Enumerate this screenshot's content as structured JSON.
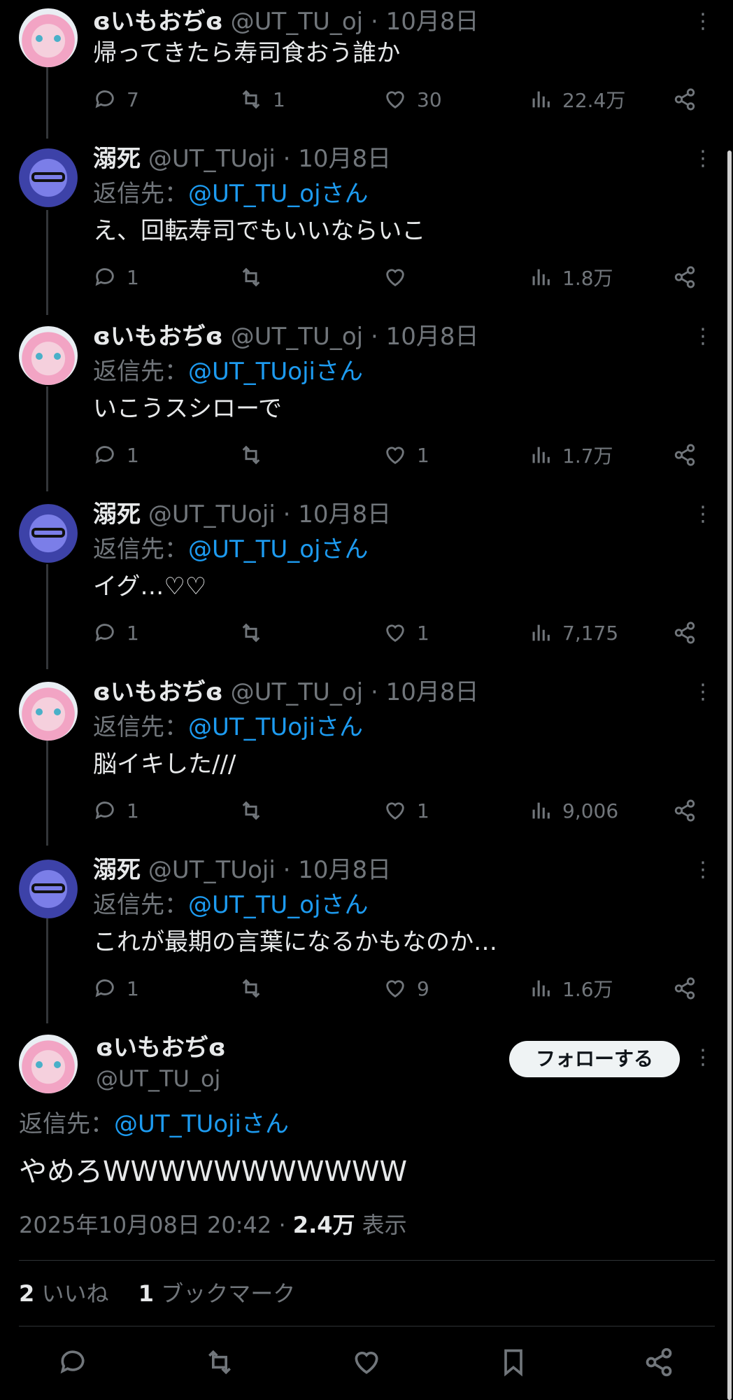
{
  "tweets": [
    {
      "name": "ɞいもおぢɞ",
      "handle": "@UT_TU_oj",
      "sep": "·",
      "date": "10月8日",
      "reply_prefix": "",
      "reply_mention": "",
      "text": "帰ってきたら寿司食おう誰か",
      "replies": "7",
      "retweets": "1",
      "likes": "30",
      "views": "22.4万"
    },
    {
      "name": "溺死",
      "handle": "@UT_TUoji",
      "sep": "·",
      "date": "10月8日",
      "reply_prefix": "返信先：",
      "reply_mention": "@UT_TU_ojさん",
      "text": "え、回転寿司でもいいならいこ",
      "replies": "1",
      "retweets": "",
      "likes": "",
      "views": "1.8万"
    },
    {
      "name": "ɞいもおぢɞ",
      "handle": "@UT_TU_oj",
      "sep": "·",
      "date": "10月8日",
      "reply_prefix": "返信先：",
      "reply_mention": "@UT_TUojiさん",
      "text": "いこうスシローで",
      "replies": "1",
      "retweets": "",
      "likes": "1",
      "views": "1.7万"
    },
    {
      "name": "溺死",
      "handle": "@UT_TUoji",
      "sep": "·",
      "date": "10月8日",
      "reply_prefix": "返信先：",
      "reply_mention": "@UT_TU_ojさん",
      "text": "イグ…♡♡",
      "replies": "1",
      "retweets": "",
      "likes": "1",
      "views": "7,175"
    },
    {
      "name": "ɞいもおぢɞ",
      "handle": "@UT_TU_oj",
      "sep": "·",
      "date": "10月8日",
      "reply_prefix": "返信先：",
      "reply_mention": "@UT_TUojiさん",
      "text": "脳イキした///",
      "replies": "1",
      "retweets": "",
      "likes": "1",
      "views": "9,006"
    },
    {
      "name": "溺死",
      "handle": "@UT_TUoji",
      "sep": "·",
      "date": "10月8日",
      "reply_prefix": "返信先：",
      "reply_mention": "@UT_TU_ojさん",
      "text": "これが最期の言葉になるかもなのか…",
      "replies": "1",
      "retweets": "",
      "likes": "9",
      "views": "1.6万"
    }
  ],
  "main": {
    "name": "ɞいもおぢɞ",
    "handle": "@UT_TU_oj",
    "follow_label": "フォローする",
    "reply_prefix": "返信先：",
    "reply_mention": "@UT_TUojiさん",
    "text": "やめろWWWWWWWWWWW",
    "timestamp": "2025年10月08日 20:42 · ",
    "views_count": "2.4万",
    "views_label": " 表示",
    "likes_count": "2",
    "likes_label": " いいね",
    "bookmarks_count": "1",
    "bookmarks_label": " ブックマーク"
  },
  "icons": {
    "reply": "reply-icon",
    "retweet": "retweet-icon",
    "like": "heart-icon",
    "views": "analytics-icon",
    "share": "share-icon",
    "bookmark": "bookmark-icon",
    "more": "more-icon"
  },
  "colors": {
    "background": "#000000",
    "text": "#e7e9ea",
    "muted": "#71767b",
    "link": "#1d9bf0",
    "follow_button": "#eff3f4"
  }
}
